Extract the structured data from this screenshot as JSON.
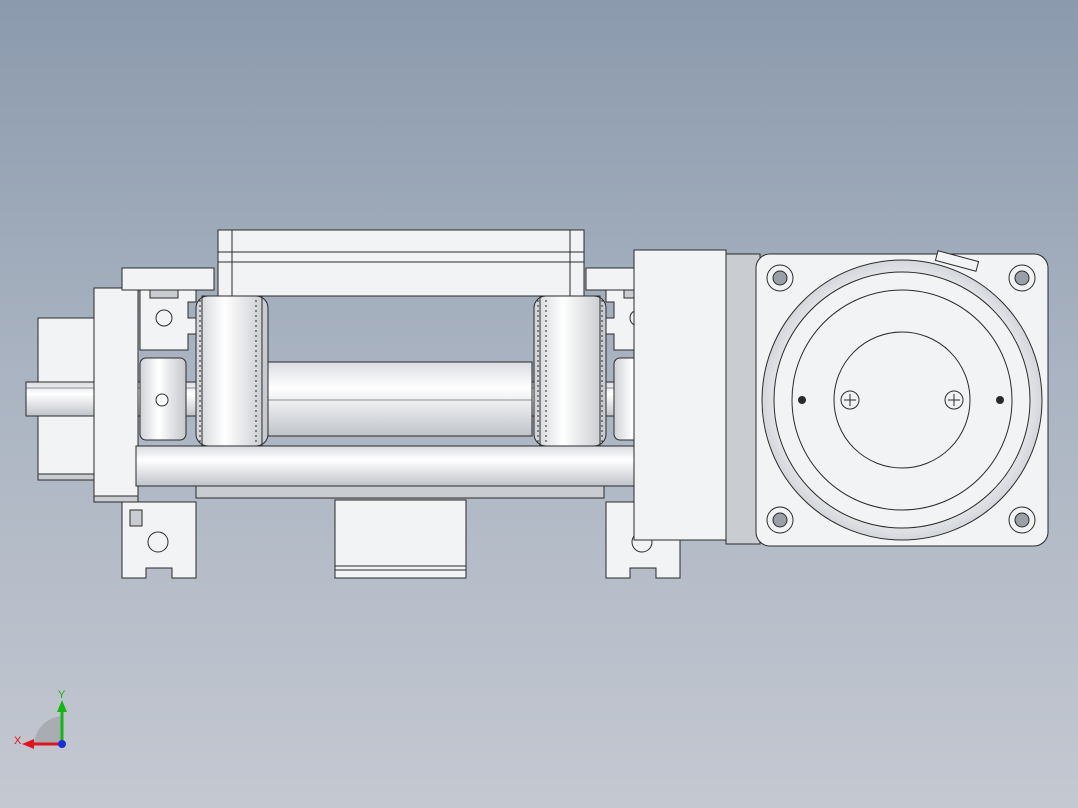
{
  "view": {
    "background_top": "#8b9aad",
    "background_bottom": "#c4c8d1",
    "part_fill": "#f2f3f5",
    "part_stroke": "#2b2b2b",
    "shade_fill": "#c9ccd1"
  },
  "triad": {
    "x_label": "X",
    "y_label": "Y",
    "x_color": "#e0141e",
    "y_color": "#15b515",
    "z_color": "#1830d8"
  }
}
